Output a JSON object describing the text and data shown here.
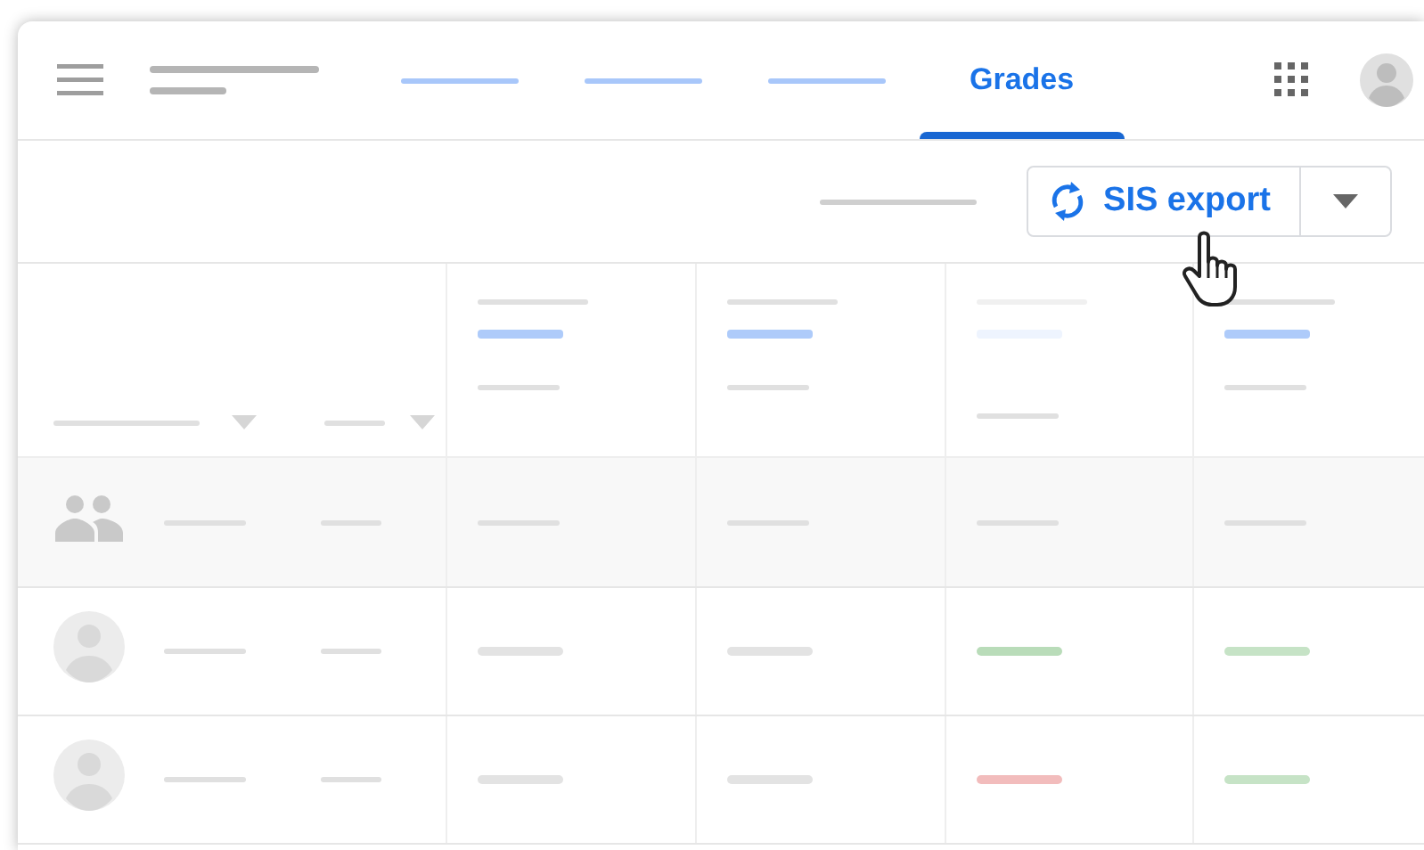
{
  "tabs": [
    {
      "selected": false
    },
    {
      "selected": false
    },
    {
      "selected": false
    },
    {
      "label": "Grades",
      "selected": true
    }
  ],
  "toolbar": {
    "export_button": "SIS export"
  },
  "columns": [
    {
      "faded": false
    },
    {
      "faded": false
    },
    {
      "faded": true
    },
    {
      "faded": false
    }
  ],
  "rows": [
    {
      "kind": "class"
    },
    {
      "kind": "student",
      "grades": [
        {
          "color": "#e3e3e3"
        },
        {
          "color": "#e3e3e3"
        },
        {
          "color": "#b9dcb9"
        },
        {
          "color": "#c6e3c6"
        }
      ]
    },
    {
      "kind": "student",
      "grades": [
        {
          "color": "#e3e3e3"
        },
        {
          "color": "#e3e3e3"
        },
        {
          "color": "#f2bcbc"
        },
        {
          "color": "#c6e3c6"
        }
      ]
    }
  ]
}
